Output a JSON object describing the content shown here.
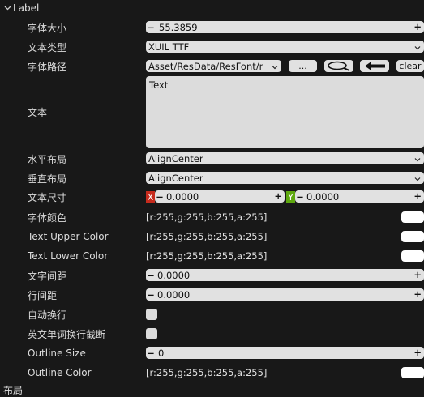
{
  "section": {
    "title": "Label",
    "next_title": "布局"
  },
  "colors": {
    "bg": "#181818",
    "field": "#e1e1e1",
    "x_badge": "#c62b1d",
    "y_badge": "#5ea80f"
  },
  "rows": {
    "font_size": {
      "label": "字体大小",
      "value": "55.3859"
    },
    "text_type": {
      "label": "文本类型",
      "value": "XUIL TTF"
    },
    "font_path": {
      "label": "字体路径",
      "value": "Asset/ResData/ResFont/r",
      "browse": "...",
      "clear": "clear"
    },
    "text": {
      "label": "文本",
      "value": "Text"
    },
    "h_layout": {
      "label": "水平布局",
      "value": "AlignCenter"
    },
    "v_layout": {
      "label": "垂直布局",
      "value": "AlignCenter"
    },
    "text_size": {
      "label": "文本尺寸",
      "x_label": "X",
      "x_value": "0.0000",
      "y_label": "Y",
      "y_value": "0.0000"
    },
    "font_color": {
      "label": "字体颜色",
      "value": "[r:255,g:255,b:255,a:255]"
    },
    "upper_color": {
      "label": "Text Upper Color",
      "value": "[r:255,g:255,b:255,a:255]"
    },
    "lower_color": {
      "label": "Text Lower Color",
      "value": "[r:255,g:255,b:255,a:255]"
    },
    "char_spacing": {
      "label": "文字间距",
      "value": "0.0000"
    },
    "line_spacing": {
      "label": "行间距",
      "value": "0.0000"
    },
    "auto_wrap": {
      "label": "自动换行",
      "checked": false
    },
    "word_break": {
      "label": "英文单词换行截断",
      "checked": false
    },
    "outline_size": {
      "label": "Outline Size",
      "value": "0"
    },
    "outline_color": {
      "label": "Outline Color",
      "value": "[r:255,g:255,b:255,a:255]"
    }
  },
  "icons": {
    "collapse": "chevron-down-icon",
    "search": "magnifier-icon",
    "locate": "arrow-left-icon"
  }
}
